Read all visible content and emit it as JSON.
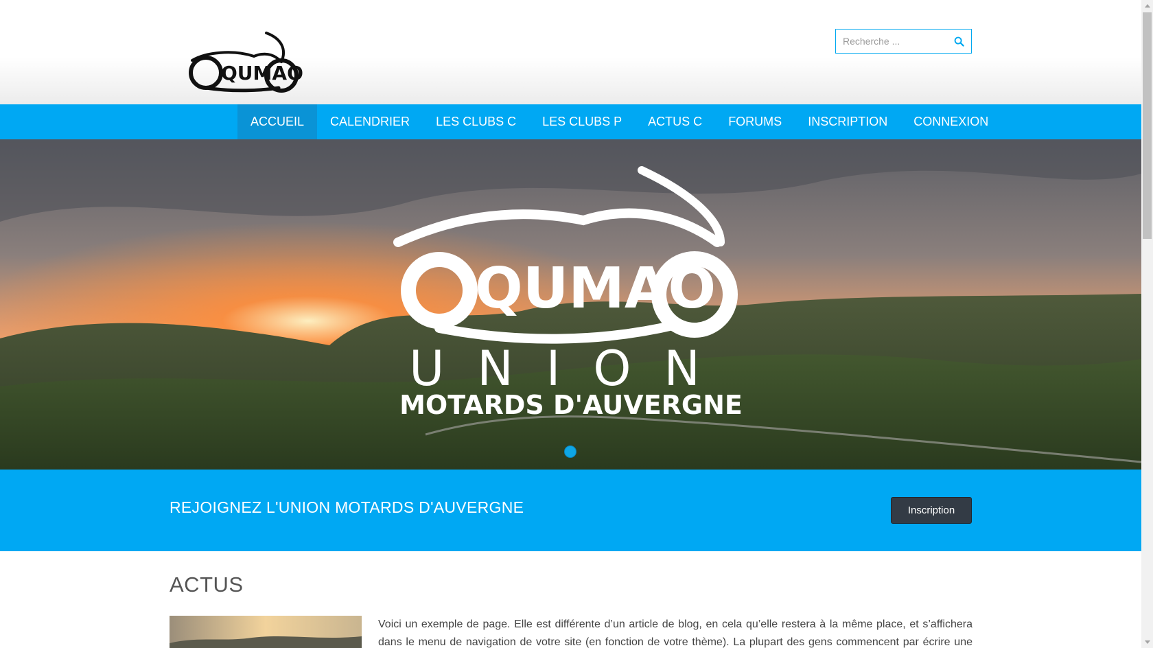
{
  "header": {
    "logo_text": "QUMAO",
    "search": {
      "placeholder": "Recherche ...",
      "icon": "search-icon"
    }
  },
  "nav": {
    "items": [
      {
        "label": "ACCUEIL",
        "active": true
      },
      {
        "label": "CALENDRIER"
      },
      {
        "label": "LES CLUBS C"
      },
      {
        "label": "LES CLUBS P"
      },
      {
        "label": "ACTUS C"
      },
      {
        "label": "FORUMS"
      },
      {
        "label": "INSCRIPTION"
      },
      {
        "label": "CONNEXION"
      }
    ]
  },
  "hero": {
    "logo_text": "QUMAO",
    "line1": "UNION",
    "line2": "MOTARDS D'AUVERGNE",
    "slide_count": 1,
    "active_slide": 1
  },
  "cta": {
    "text": "REJOIGNEZ L'UNION MOTARDS D'AUVERGNE",
    "button_label": "Inscription"
  },
  "content": {
    "section_title": "ACTUS",
    "excerpt": "Voici un exemple de page. Elle est différente d’un article de blog, en cela qu’elle restera à la même place, et s’affichera dans le menu de navigation de votre site (en fonction de votre thème). La plupart des gens commencent par écrire une page « À"
  },
  "colors": {
    "accent": "#00a8f3",
    "nav_active": "#0a93d6",
    "button_dark": "#333b45"
  }
}
